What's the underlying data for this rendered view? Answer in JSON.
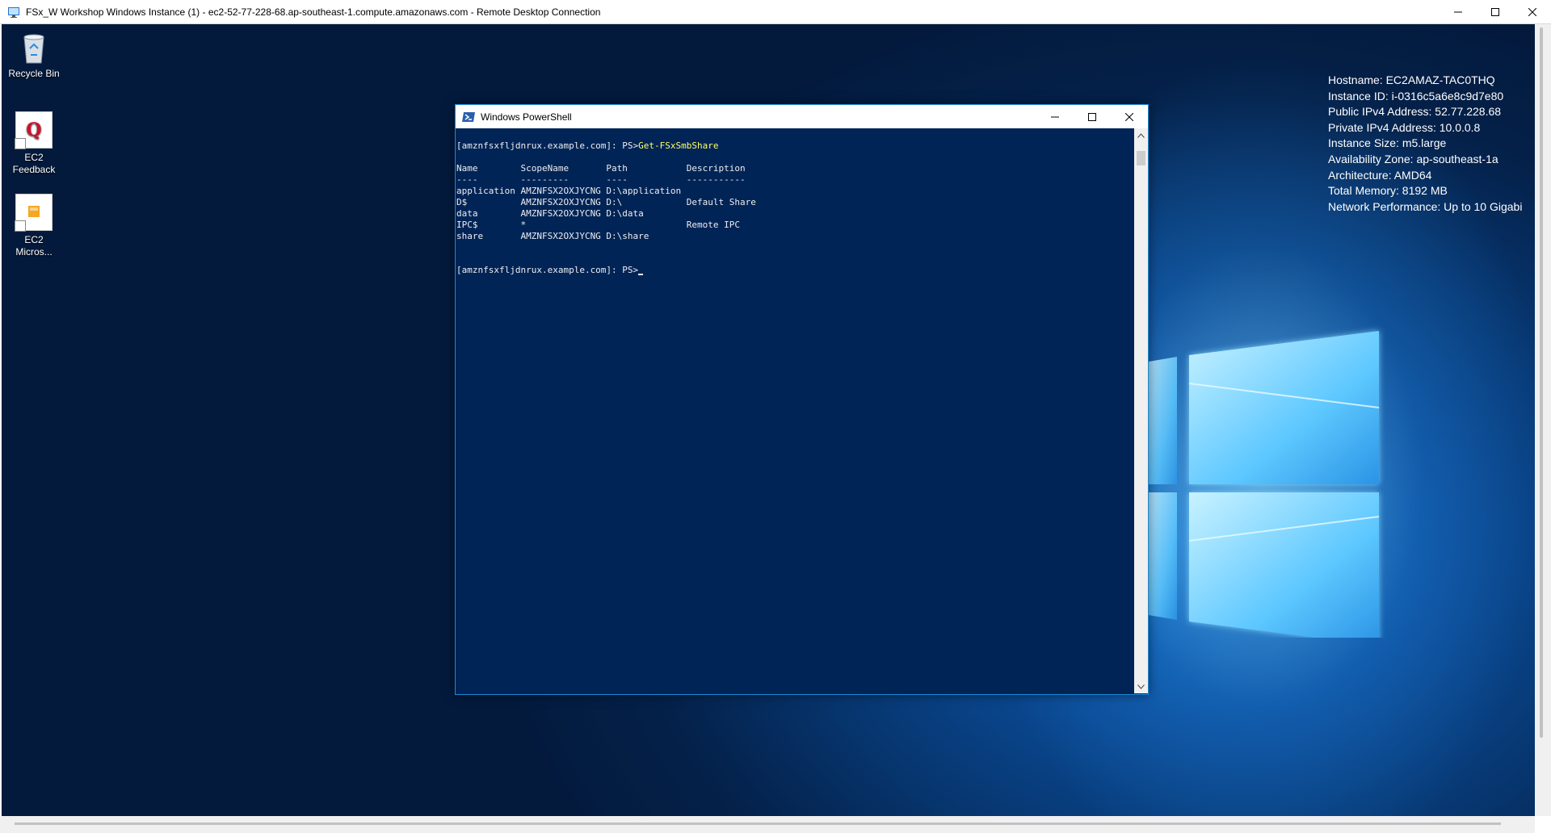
{
  "rdp": {
    "title": "FSx_W Workshop Windows Instance (1) - ec2-52-77-228-68.ap-southeast-1.compute.amazonaws.com - Remote Desktop Connection"
  },
  "desktop": {
    "icons": [
      {
        "label": "Recycle Bin",
        "icon": "recycle-bin-icon"
      },
      {
        "label": "EC2\nFeedback",
        "icon": "ec2-feedback-icon"
      },
      {
        "label": "EC2\nMicros...",
        "icon": "ec2-microsoft-icon"
      }
    ],
    "bginfo": [
      "Hostname: EC2AMAZ-TAC0THQ",
      "Instance ID: i-0316c5a6e8c9d7e80",
      "Public IPv4 Address: 52.77.228.68",
      "Private IPv4 Address: 10.0.0.8",
      "Instance Size: m5.large",
      "Availability Zone: ap-southeast-1a",
      "Architecture: AMD64",
      "Total Memory: 8192 MB",
      "Network Performance: Up to 10 Gigabi"
    ]
  },
  "powershell": {
    "title": "Windows PowerShell",
    "prompt": "[amznfsxfljdnrux.example.com]: PS>",
    "command": "Get-FSxSmbShare",
    "lines": [
      "Name        ScopeName       Path           Description",
      "----        ---------       ----           -----------",
      "application AMZNFSX2OXJYCNG D:\\application",
      "D$          AMZNFSX2OXJYCNG D:\\            Default Share",
      "data        AMZNFSX2OXJYCNG D:\\data",
      "IPC$        *                              Remote IPC",
      "share       AMZNFSX2OXJYCNG D:\\share"
    ]
  },
  "colors": {
    "console_bg": "#012456",
    "command_text": "#ffff66"
  }
}
